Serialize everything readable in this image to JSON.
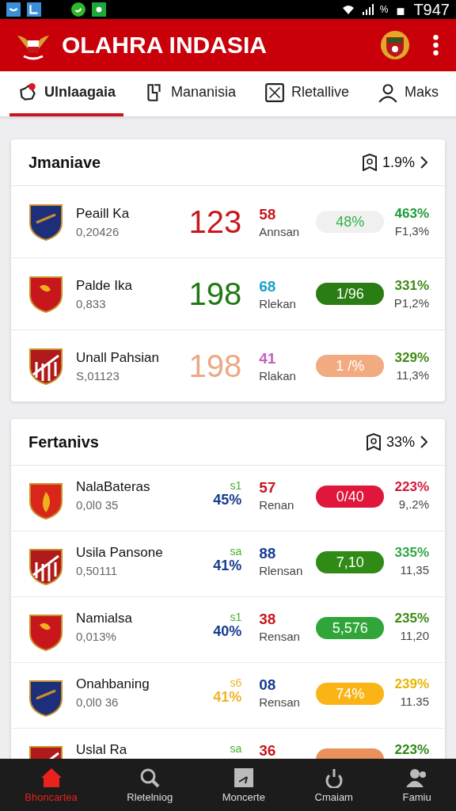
{
  "status_bar": {
    "time": "T947",
    "battery": "%"
  },
  "header": {
    "title": "OLAHRA INDASIA"
  },
  "tabs": [
    {
      "label": "Ulnlaagaia",
      "selected": true
    },
    {
      "label": "Mananisia",
      "selected": false
    },
    {
      "label": "Rletallive",
      "selected": false
    },
    {
      "label": "Maks",
      "selected": false
    }
  ],
  "cards": [
    {
      "title": "Jmaniave",
      "summary": "1.9%",
      "rows": [
        {
          "kind": "score",
          "name": "Peaill Ka",
          "code": "0,20426",
          "score": {
            "text": "123",
            "color": "#c8161d"
          },
          "num": {
            "text": "58",
            "color": "#c8161d"
          },
          "label": "Annsan",
          "pill": {
            "kind": "soft",
            "text": "48%",
            "color": "#2fb548"
          },
          "pct": {
            "text": "463%",
            "color": "#1e9a3a"
          },
          "sub": "F1,3%"
        },
        {
          "kind": "score",
          "name": "Palde Ika",
          "code": "0,833",
          "score": {
            "text": "198",
            "color": "#1f7a12"
          },
          "num": {
            "text": "68",
            "color": "#1aa0c8"
          },
          "label": "Rlekan",
          "pill": {
            "kind": "solid",
            "text": "1/96",
            "color": "#2a7d12"
          },
          "pct": {
            "text": "331%",
            "color": "#3d8a12"
          },
          "sub": "P1,2%"
        },
        {
          "kind": "score",
          "name": "Unall Pahsian",
          "code": "S,01123",
          "score": {
            "text": "198",
            "color": "#eca887"
          },
          "num": {
            "text": "41",
            "color": "#c064c0"
          },
          "label": "Rlakan",
          "pill": {
            "kind": "solid",
            "text": "1 /%",
            "color": "#f2aa80"
          },
          "pct": {
            "text": "329%",
            "color": "#3d8a12"
          },
          "sub": "11,3%"
        }
      ]
    },
    {
      "title": "Fertanivs",
      "summary": "33%",
      "rows": [
        {
          "kind": "split",
          "name": "NalaBateras",
          "code": "0,0l0 35",
          "small": {
            "text": "s1",
            "color": "#4caf2c"
          },
          "share": {
            "text": "45%",
            "color": "#163d8f"
          },
          "num": {
            "text": "57",
            "color": "#c8161d"
          },
          "label": "Renan",
          "pill": {
            "kind": "solid",
            "text": "0/40",
            "color": "#e0163a"
          },
          "pct": {
            "text": "223%",
            "color": "#d4163a"
          },
          "sub": "9,.2%"
        },
        {
          "kind": "split",
          "name": "Usila Pansone",
          "code": "0,50111",
          "small": {
            "text": "sa",
            "color": "#4caf2c"
          },
          "share": {
            "text": "41%",
            "color": "#163d8f"
          },
          "num": {
            "text": "88",
            "color": "#163d8f"
          },
          "label": "Rlensan",
          "pill": {
            "kind": "solid",
            "text": "7,10",
            "color": "#2f8a16"
          },
          "pct": {
            "text": "335%",
            "color": "#2fa548"
          },
          "sub": "11,35"
        },
        {
          "kind": "split",
          "name": "Namialsa",
          "code": "0,013%",
          "small": {
            "text": "s1",
            "color": "#4caf2c"
          },
          "share": {
            "text": "40%",
            "color": "#163d8f"
          },
          "num": {
            "text": "38",
            "color": "#c8161d"
          },
          "label": "Rensan",
          "pill": {
            "kind": "solid",
            "text": "5,576",
            "color": "#2fa53a"
          },
          "pct": {
            "text": "235%",
            "color": "#3d8a12"
          },
          "sub": "11,20"
        },
        {
          "kind": "split",
          "name": "Onahbaning",
          "code": "0,0l0 36",
          "small": {
            "text": "s6",
            "color": "#f0b429"
          },
          "share": {
            "text": "41%",
            "color": "#f0b429"
          },
          "num": {
            "text": "08",
            "color": "#163d8f"
          },
          "label": "Rensan",
          "pill": {
            "kind": "solid",
            "text": "74%",
            "color": "#fbb416"
          },
          "pct": {
            "text": "239%",
            "color": "#e8b400"
          },
          "sub": "11.35"
        },
        {
          "kind": "split",
          "name": "Uslal Ra",
          "small": {
            "text": "sa",
            "color": "#4caf2c"
          },
          "num": {
            "text": "36",
            "color": "#c8161d"
          },
          "pill": {
            "kind": "solid",
            "color": "#e8915a"
          },
          "pct": {
            "text": "223%",
            "color": "#2a8a12"
          }
        }
      ]
    }
  ],
  "nav": [
    {
      "label": "Bhoncartea",
      "selected": true
    },
    {
      "label": "Rletelniog",
      "selected": false
    },
    {
      "label": "Moncerte",
      "selected": false
    },
    {
      "label": "Cmaiam",
      "selected": false
    },
    {
      "label": "Famiu",
      "selected": false
    }
  ]
}
